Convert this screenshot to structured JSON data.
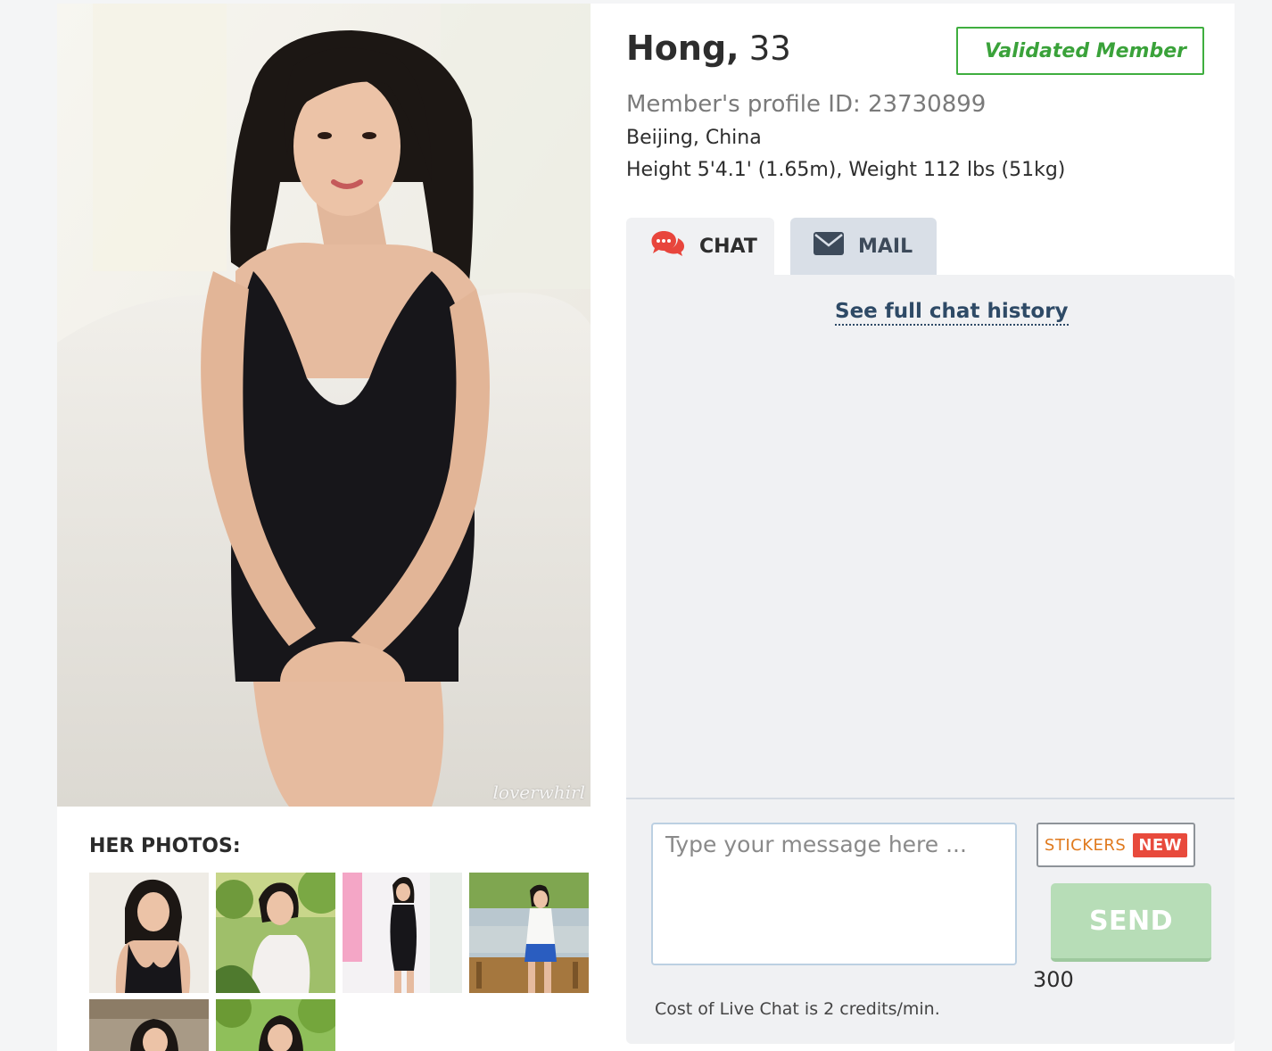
{
  "profile": {
    "name": "Hong,",
    "age": "33",
    "validated_label": "Validated Member",
    "profile_id": "Member's profile ID: 23730899",
    "location": "Beijing, China",
    "height_weight": "Height 5'4.1' (1.65m), Weight 112 lbs (51kg)"
  },
  "photo": {
    "watermark": "loverwhirl"
  },
  "photos_section": {
    "title": "HER PHOTOS:",
    "thumbnails": [
      "photo-1",
      "photo-2",
      "photo-3",
      "photo-4",
      "photo-5",
      "photo-6"
    ]
  },
  "tabs": [
    {
      "label": "CHAT",
      "icon": "chat-bubbles-icon",
      "active": true
    },
    {
      "label": "MAIL",
      "icon": "envelope-icon",
      "active": false
    }
  ],
  "chat": {
    "history_link": "See full chat history",
    "input_placeholder": "Type your message here ...",
    "stickers_label": "STICKERS",
    "new_badge": "NEW",
    "send_label": "SEND",
    "char_count": "300",
    "cost_text": "Cost of Live Chat is 2 credits/min."
  },
  "colors": {
    "validated_green": "#3aa23a",
    "send_disabled": "#b7ddb7",
    "stickers_orange": "#e07a1e",
    "new_badge_red": "#e84a3c",
    "link_navy": "#2e4a66",
    "chat_icon_red": "#e8453c"
  }
}
